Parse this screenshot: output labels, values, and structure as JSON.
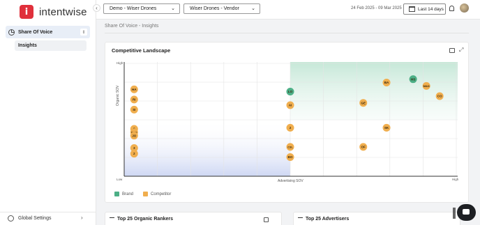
{
  "app": {
    "brand": "intentwise"
  },
  "sidebar": {
    "group_label": "Share Of Voice",
    "sub_item": "Insights",
    "settings_label": "Global Settings"
  },
  "topbar": {
    "account_select": "Demo - Wiser Drones",
    "vendor_select": "Wiser Drones - Vendor",
    "date_range": "24 Feb 2025 - 09 Mar 2025",
    "date_button": "Last 14 days"
  },
  "breadcrumb": "Share Of Voice - Insights",
  "card": {
    "title": "Competitive Landscape"
  },
  "colors": {
    "brand": "#4caf86",
    "competitor": "#f0ae4e",
    "accent": "#e0303b"
  },
  "chart_data": {
    "type": "scatter",
    "xlabel": "Advertising SOV",
    "ylabel": "Organic SOV",
    "x_ticks": {
      "low": "Low",
      "high": "High"
    },
    "y_ticks": {
      "low": "Low",
      "high": "High"
    },
    "legend": [
      "Brand",
      "Competitor"
    ],
    "legend_position": "bottom-left",
    "grid": true,
    "points": [
      {
        "label": "HA",
        "series": "Competitor",
        "x": 0.03,
        "y": 0.77
      },
      {
        "label": "RI",
        "series": "Competitor",
        "x": 0.03,
        "y": 0.68
      },
      {
        "label": "SI",
        "series": "Competitor",
        "x": 0.03,
        "y": 0.59
      },
      {
        "label": "S",
        "series": "Competitor",
        "x": 0.03,
        "y": 0.42
      },
      {
        "label": "BOS",
        "series": "Competitor",
        "x": 0.03,
        "y": 0.39
      },
      {
        "label": "JO",
        "series": "Competitor",
        "x": 0.03,
        "y": 0.36
      },
      {
        "label": "3",
        "series": "Competitor",
        "x": 0.03,
        "y": 0.25
      },
      {
        "label": "2",
        "series": "Competitor",
        "x": 0.03,
        "y": 0.2
      },
      {
        "label": "LO",
        "series": "Brand",
        "x": 0.5,
        "y": 0.75
      },
      {
        "label": "AI",
        "series": "Competitor",
        "x": 0.5,
        "y": 0.63
      },
      {
        "label": "2",
        "series": "Competitor",
        "x": 0.5,
        "y": 0.43
      },
      {
        "label": "C3L",
        "series": "Competitor",
        "x": 0.5,
        "y": 0.26
      },
      {
        "label": "BO",
        "series": "Competitor",
        "x": 0.5,
        "y": 0.17
      },
      {
        "label": "GE",
        "series": "Competitor",
        "x": 0.72,
        "y": 0.65
      },
      {
        "label": "OF",
        "series": "Competitor",
        "x": 0.72,
        "y": 0.26
      },
      {
        "label": "BA",
        "series": "Competitor",
        "x": 0.79,
        "y": 0.83
      },
      {
        "label": "SK",
        "series": "Competitor",
        "x": 0.79,
        "y": 0.43
      },
      {
        "label": "HS",
        "series": "Brand",
        "x": 0.87,
        "y": 0.86
      },
      {
        "label": "M&D",
        "series": "Competitor",
        "x": 0.91,
        "y": 0.8
      },
      {
        "label": "CO",
        "series": "Competitor",
        "x": 0.95,
        "y": 0.71
      }
    ]
  },
  "panels": {
    "left_title": "Top 25 Organic Rankers",
    "right_title": "Top 25 Advertisers"
  }
}
